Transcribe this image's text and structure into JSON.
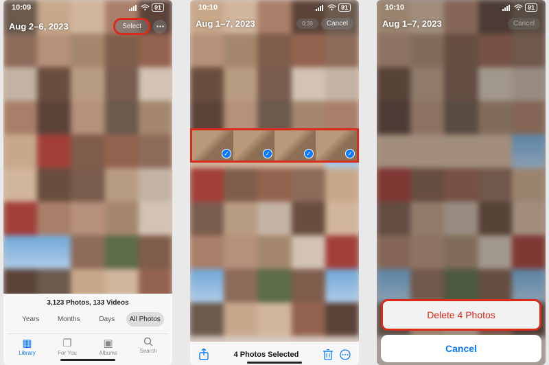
{
  "screen1": {
    "status": {
      "time": "10:09",
      "battery": "91"
    },
    "date_range": "Aug 2–6, 2023",
    "select_label": "Select",
    "count_line": "3,123 Photos, 133 Videos",
    "segments": {
      "years": "Years",
      "months": "Months",
      "days": "Days",
      "all": "All Photos"
    },
    "tabs": {
      "library": "Library",
      "foryou": "For You",
      "albums": "Albums",
      "search": "Search"
    }
  },
  "screen2": {
    "status": {
      "time": "10:10",
      "battery": "91"
    },
    "date_range": "Aug 1–7, 2023",
    "cancel_label": "Cancel",
    "video_badge": "0:33",
    "selected_text": "4 Photos Selected"
  },
  "screen3": {
    "status": {
      "time": "10:10",
      "battery": "91"
    },
    "date_range": "Aug 1–7, 2023",
    "cancel_top": "Cancel",
    "delete_label": "Delete 4 Photos",
    "cancel_sheet": "Cancel"
  }
}
